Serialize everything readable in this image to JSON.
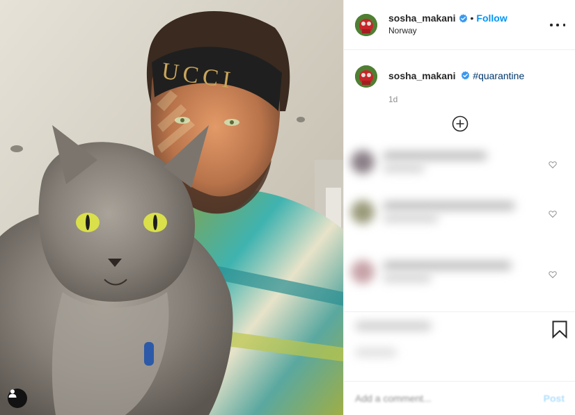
{
  "post": {
    "username": "sosha_makani",
    "verified": true,
    "follow_label": "Follow",
    "separator": "•",
    "location": "Norway",
    "more_icon": "more-horizontal-icon",
    "caption_hashtag": "#quarantine",
    "timestamp": "1d",
    "load_more_icon": "plus-circle-icon",
    "tag_icon": "user-tag-icon",
    "save_icon": "bookmark-icon",
    "comment_input": {
      "placeholder": "Add a comment...",
      "value": ""
    },
    "post_label": "Post"
  },
  "colors": {
    "accent": "#0095f6",
    "hashtag": "#00376b",
    "muted": "#8e8e8e",
    "post_disabled": "#b2dffc",
    "border": "#efefef"
  },
  "comments": [
    {
      "avatar_color": "#8a7f86",
      "liked": false
    },
    {
      "avatar_color": "#9a9a7a",
      "liked": false
    },
    {
      "avatar_color": "#c7a3a8",
      "liked": false
    },
    {
      "avatar_color": "#d8d8d8",
      "liked": false
    }
  ]
}
